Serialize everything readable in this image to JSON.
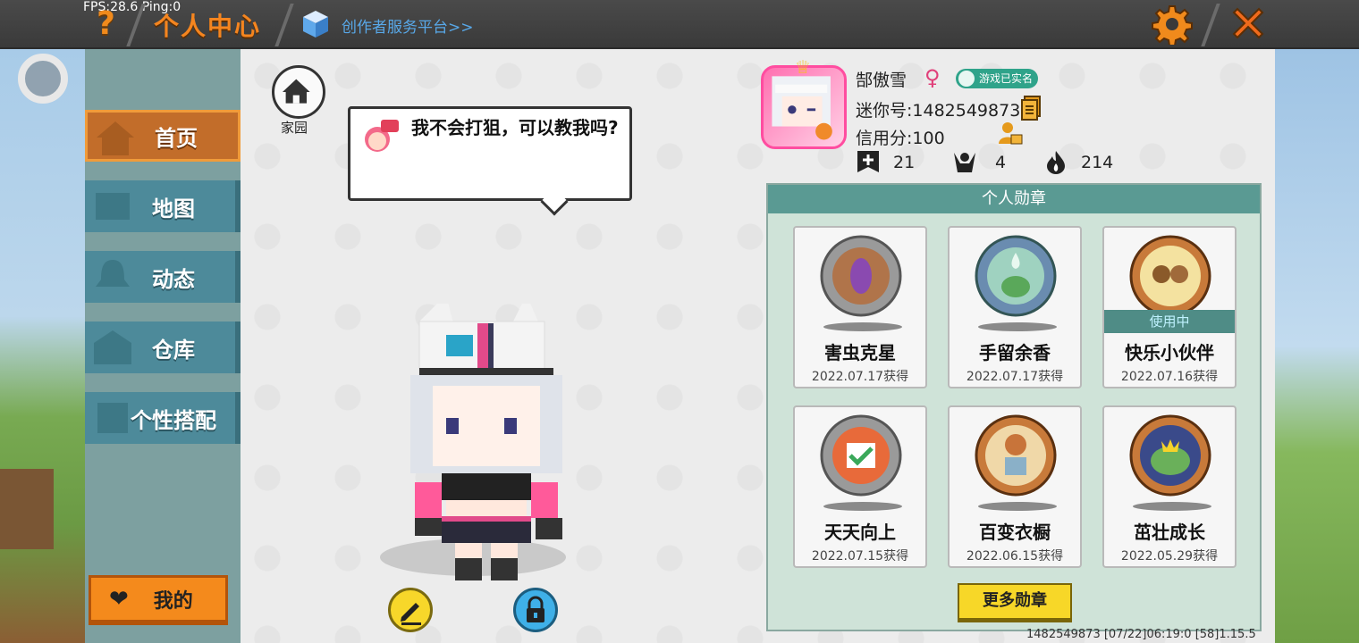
{
  "debug": {
    "fps_text": "FPS:28.6  Ping:0"
  },
  "header": {
    "title": "个人中心",
    "creator_link": "创作者服务平台>>",
    "help_icon": "question-icon",
    "settings_icon": "gear-icon",
    "close_icon": "close-icon",
    "accent_color": "#f5851f"
  },
  "sidebar": {
    "items": [
      {
        "label": "首页",
        "icon": "house-icon",
        "active": true
      },
      {
        "label": "地图",
        "icon": "map-icon",
        "active": false
      },
      {
        "label": "动态",
        "icon": "bell-icon",
        "active": false
      },
      {
        "label": "仓库",
        "icon": "warehouse-icon",
        "active": false
      },
      {
        "label": "个性搭配",
        "icon": "outfit-icon",
        "active": false
      }
    ],
    "mine_button": "我的"
  },
  "main": {
    "home_label": "家园",
    "bubble_text": "我不会打狙，可以教我吗?",
    "edit_icon": "pencil-icon",
    "lock_icon": "lock-icon"
  },
  "profile": {
    "name": "郜傲雪",
    "gender_icon": "female-icon",
    "realname_badge": "游戏已实名",
    "mini_id": "迷你号:1482549873",
    "credit": "信用分:100",
    "stats": [
      {
        "icon": "plus-icon",
        "value": "21"
      },
      {
        "icon": "fans-icon",
        "value": "4"
      },
      {
        "icon": "fire-icon",
        "value": "214"
      }
    ]
  },
  "badges": {
    "title": "个人勋章",
    "items": [
      {
        "name": "害虫克星",
        "date": "2022.07.17获得",
        "in_use": false
      },
      {
        "name": "手留余香",
        "date": "2022.07.17获得",
        "in_use": false
      },
      {
        "name": "快乐小伙伴",
        "date": "2022.07.16获得",
        "in_use": true
      },
      {
        "name": "天天向上",
        "date": "2022.07.15获得",
        "in_use": false
      },
      {
        "name": "百变衣橱",
        "date": "2022.06.15获得",
        "in_use": false
      },
      {
        "name": "茁壮成长",
        "date": "2022.05.29获得",
        "in_use": false
      }
    ],
    "in_use_label": "使用中",
    "more_button": "更多勋章"
  },
  "footer": {
    "info": "1482549873   [07/22]06:19:0   [58]1.15.5"
  }
}
